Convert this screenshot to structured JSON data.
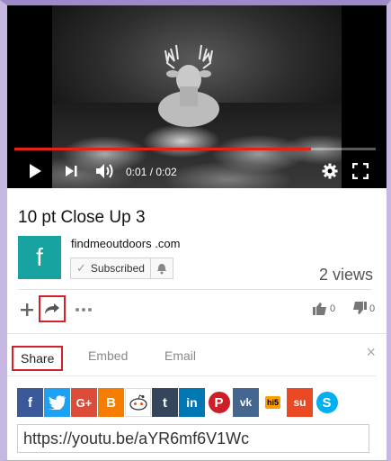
{
  "player": {
    "time_display": "0:01 / 0:02",
    "progress": 0.82,
    "accent_color": "#e62117",
    "icons": [
      "play-icon",
      "next-icon",
      "volume-icon",
      "settings-gear-icon",
      "fullscreen-icon"
    ]
  },
  "video": {
    "title": "10 pt Close Up 3",
    "views": "2 views"
  },
  "channel": {
    "name": "findmeoutdoors .com",
    "logo_letter": "f",
    "logo_color": "#17a3a0",
    "subscribe_label": "Subscribed"
  },
  "actions": {
    "likes": "0",
    "dislikes": "0",
    "highlight_color": "#d61f26"
  },
  "share_panel": {
    "tabs": [
      {
        "label": "Share",
        "active": true
      },
      {
        "label": "Embed",
        "active": false
      },
      {
        "label": "Email",
        "active": false
      }
    ],
    "close_label": "×",
    "social": [
      {
        "name": "facebook",
        "glyph": "f",
        "color": "#3b5998"
      },
      {
        "name": "twitter",
        "glyph": "t",
        "color": "#1da1f2"
      },
      {
        "name": "google-plus",
        "glyph": "G+",
        "color": "#dd4b39"
      },
      {
        "name": "blogger",
        "glyph": "B",
        "color": "#f57d00"
      },
      {
        "name": "reddit",
        "glyph": "r",
        "color": "#ffffff"
      },
      {
        "name": "tumblr",
        "glyph": "t",
        "color": "#35465c"
      },
      {
        "name": "linkedin",
        "glyph": "in",
        "color": "#0077b5"
      },
      {
        "name": "pinterest",
        "glyph": "P",
        "color": "#ffffff"
      },
      {
        "name": "vk",
        "glyph": "vk",
        "color": "#45668e"
      },
      {
        "name": "hi5",
        "glyph": "hi5",
        "color": "#ffffff"
      },
      {
        "name": "stumbleupon",
        "glyph": "su",
        "color": "#eb4924"
      },
      {
        "name": "skype",
        "glyph": "S",
        "color": "#00aff0"
      }
    ],
    "url": "https://youtu.be/aYR6mf6V1Wc"
  }
}
